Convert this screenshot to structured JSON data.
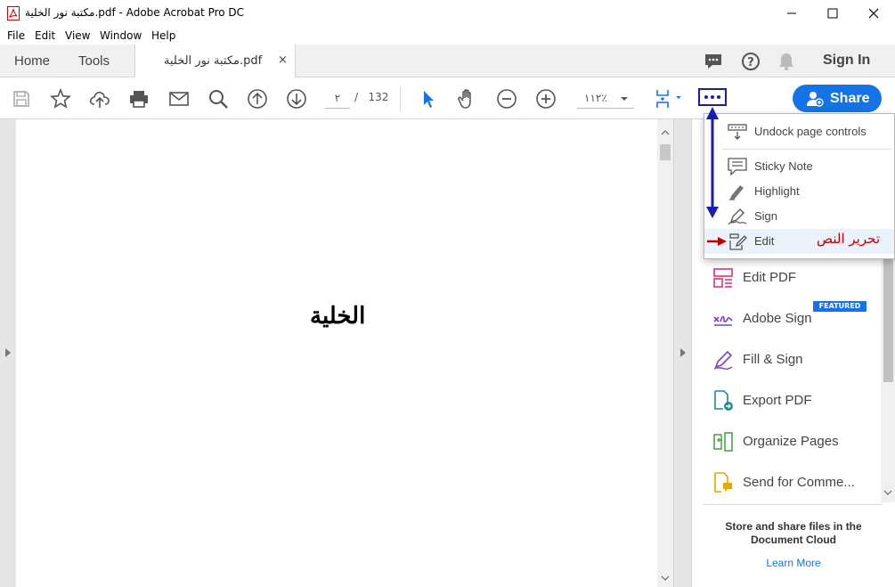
{
  "window": {
    "title": "مكتبة نور الخلية.pdf - Adobe Acrobat Pro DC"
  },
  "menu": [
    "File",
    "Edit",
    "View",
    "Window",
    "Help"
  ],
  "tabs": {
    "home": "Home",
    "tools": "Tools",
    "document": "مكتبة نور الخلية.pdf",
    "close": "×",
    "sign_in": "Sign In"
  },
  "toolbar": {
    "current_page": "٢",
    "page_separator": "/",
    "total_pages": "132",
    "zoom": "١١٢٪",
    "share_label": "Share"
  },
  "document": {
    "heading": "الخلية"
  },
  "dropdown": {
    "items": [
      {
        "label": "Undock page controls",
        "icon": "undock-icon"
      },
      {
        "label": "Sticky Note",
        "icon": "sticky-note-icon"
      },
      {
        "label": "Highlight",
        "icon": "highlight-icon"
      },
      {
        "label": "Sign",
        "icon": "sign-pen-icon"
      },
      {
        "label": "Edit",
        "icon": "edit-icon"
      }
    ],
    "annotation": "تحرير النص"
  },
  "tools_pane": {
    "items": [
      {
        "label": "Edit PDF",
        "icon": "edit-pdf-icon"
      },
      {
        "label": "Adobe Sign",
        "icon": "adobe-sign-icon"
      },
      {
        "label": "Fill & Sign",
        "icon": "fill-sign-icon"
      },
      {
        "label": "Export PDF",
        "icon": "export-pdf-icon"
      },
      {
        "label": "Organize Pages",
        "icon": "organize-pages-icon"
      },
      {
        "label": "Send for Comme...",
        "icon": "send-comment-icon"
      }
    ],
    "featured_badge": "FEATURED",
    "cloud_text": "Store and share files in the Document Cloud",
    "learn_more": "Learn More"
  },
  "colors": {
    "accent": "#1473e6",
    "annotation_blue": "#1a1ab5",
    "annotation_red": "#c00000"
  }
}
